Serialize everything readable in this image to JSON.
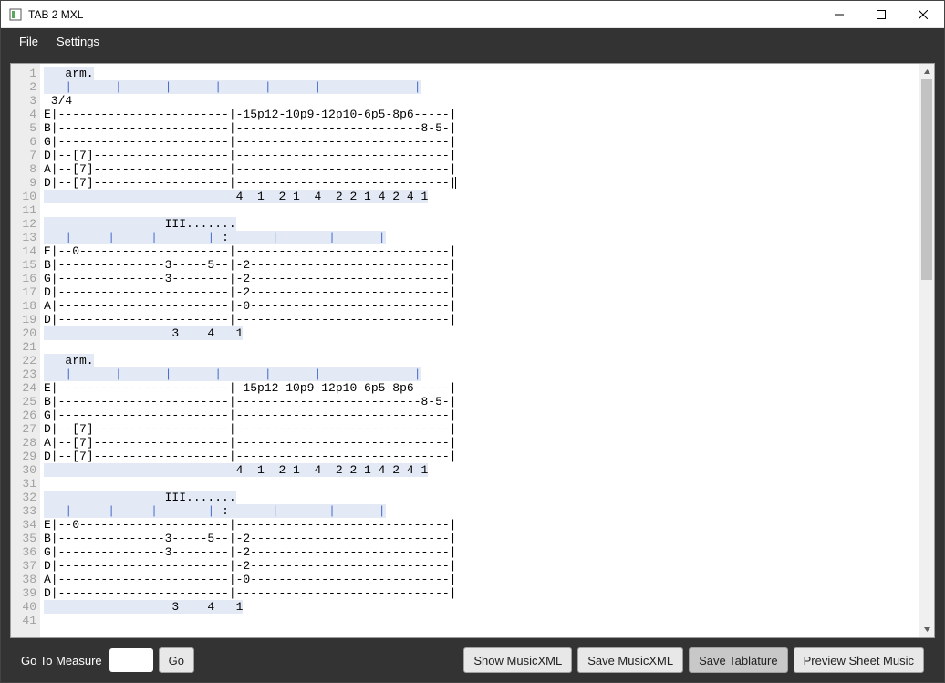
{
  "window": {
    "title": "TAB 2 MXL"
  },
  "menu": {
    "file": "File",
    "settings": "Settings"
  },
  "bottom": {
    "goto_label": "Go To Measure",
    "goto_value": "",
    "go": "Go",
    "show_mxl": "Show MusicXML",
    "save_mxl": "Save MusicXML",
    "save_tab": "Save Tablature",
    "preview": "Preview Sheet Music"
  },
  "editor": {
    "first_line_no": 1,
    "line_count": 41,
    "lines": [
      {
        "t": "   arm.",
        "hl": true
      },
      {
        "pipes": [
          3,
          10,
          17,
          24,
          31,
          38,
          52
        ],
        "hl": true
      },
      {
        "t": " 3/4",
        "hl": false
      },
      {
        "t": "E|------------------------|-15p12-10p9-12p10-6p5-8p6-----|",
        "hl": false
      },
      {
        "t": "B|------------------------|--------------------------8-5-|",
        "hl": false
      },
      {
        "t": "G|------------------------|------------------------------|",
        "hl": false
      },
      {
        "t": "D|--[7]-------------------|------------------------------|",
        "hl": false
      },
      {
        "t": "A|--[7]-------------------|------------------------------|",
        "hl": false
      },
      {
        "t": "D|--[7]-------------------|------------------------------|",
        "hl": false,
        "caret": true
      },
      {
        "t": "                           4  1  2 1  4  2 2 1 4 2 4 1",
        "hl": true
      },
      {
        "t": "",
        "hl": false
      },
      {
        "t": "                 III.......",
        "hl": true
      },
      {
        "pipes": [
          3,
          9,
          15,
          23,
          32,
          40,
          47
        ],
        "colon": 25,
        "hl": true
      },
      {
        "t": "E|--0---------------------|------------------------------|",
        "hl": false
      },
      {
        "t": "B|---------------3-----5--|-2----------------------------|",
        "hl": false
      },
      {
        "t": "G|---------------3--------|-2----------------------------|",
        "hl": false
      },
      {
        "t": "D|------------------------|-2----------------------------|",
        "hl": false
      },
      {
        "t": "A|------------------------|-0----------------------------|",
        "hl": false
      },
      {
        "t": "D|------------------------|------------------------------|",
        "hl": false
      },
      {
        "t": "                  3    4   1",
        "hl": true
      },
      {
        "t": "",
        "hl": false
      },
      {
        "t": "   arm.",
        "hl": true
      },
      {
        "pipes": [
          3,
          10,
          17,
          24,
          31,
          38,
          52
        ],
        "hl": true
      },
      {
        "t": "E|------------------------|-15p12-10p9-12p10-6p5-8p6-----|",
        "hl": false
      },
      {
        "t": "B|------------------------|--------------------------8-5-|",
        "hl": false
      },
      {
        "t": "G|------------------------|------------------------------|",
        "hl": false
      },
      {
        "t": "D|--[7]-------------------|------------------------------|",
        "hl": false
      },
      {
        "t": "A|--[7]-------------------|------------------------------|",
        "hl": false
      },
      {
        "t": "D|--[7]-------------------|------------------------------|",
        "hl": false
      },
      {
        "t": "                           4  1  2 1  4  2 2 1 4 2 4 1",
        "hl": true
      },
      {
        "t": "",
        "hl": false
      },
      {
        "t": "                 III.......",
        "hl": true
      },
      {
        "pipes": [
          3,
          9,
          15,
          23,
          32,
          40,
          47
        ],
        "colon": 25,
        "hl": true
      },
      {
        "t": "E|--0---------------------|------------------------------|",
        "hl": false
      },
      {
        "t": "B|---------------3-----5--|-2----------------------------|",
        "hl": false
      },
      {
        "t": "G|---------------3--------|-2----------------------------|",
        "hl": false
      },
      {
        "t": "D|------------------------|-2----------------------------|",
        "hl": false
      },
      {
        "t": "A|------------------------|-0----------------------------|",
        "hl": false
      },
      {
        "t": "D|------------------------|------------------------------|",
        "hl": false
      },
      {
        "t": "                  3    4   1",
        "hl": true
      },
      {
        "t": "",
        "hl": true
      }
    ]
  }
}
